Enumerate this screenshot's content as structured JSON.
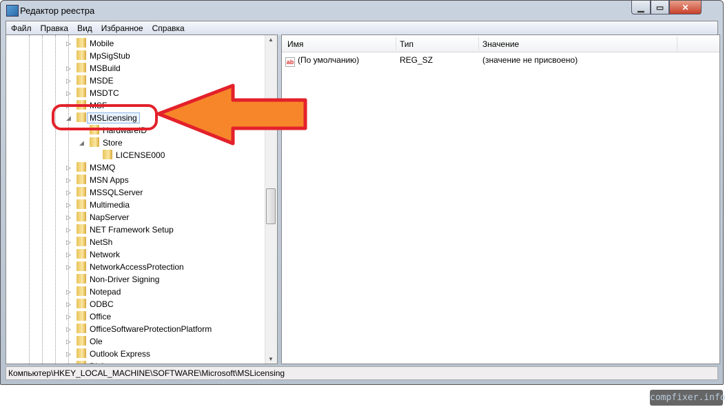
{
  "window": {
    "title": "Редактор реестра",
    "minimize": "▁",
    "maximize": "▭",
    "close": "✕"
  },
  "menu": [
    "Файл",
    "Правка",
    "Вид",
    "Избранное",
    "Справка"
  ],
  "tree": [
    {
      "label": "Mobile",
      "level": 0,
      "expander": "collapsed"
    },
    {
      "label": "MpSigStub",
      "level": 0,
      "expander": "none"
    },
    {
      "label": "MSBuild",
      "level": 0,
      "expander": "collapsed"
    },
    {
      "label": "MSDE",
      "level": 0,
      "expander": "collapsed"
    },
    {
      "label": "MSDTC",
      "level": 0,
      "expander": "collapsed"
    },
    {
      "label": "MSF",
      "level": 0,
      "expander": "collapsed"
    },
    {
      "label": "MSLicensing",
      "level": 0,
      "expander": "expanded",
      "selected": true
    },
    {
      "label": "HardwareID",
      "level": 1,
      "expander": "none"
    },
    {
      "label": "Store",
      "level": 1,
      "expander": "expanded"
    },
    {
      "label": "LICENSE000",
      "level": 2,
      "expander": "none"
    },
    {
      "label": "MSMQ",
      "level": 0,
      "expander": "collapsed"
    },
    {
      "label": "MSN Apps",
      "level": 0,
      "expander": "collapsed"
    },
    {
      "label": "MSSQLServer",
      "level": 0,
      "expander": "collapsed"
    },
    {
      "label": "Multimedia",
      "level": 0,
      "expander": "collapsed"
    },
    {
      "label": "NapServer",
      "level": 0,
      "expander": "collapsed"
    },
    {
      "label": "NET Framework Setup",
      "level": 0,
      "expander": "collapsed"
    },
    {
      "label": "NetSh",
      "level": 0,
      "expander": "collapsed"
    },
    {
      "label": "Network",
      "level": 0,
      "expander": "collapsed"
    },
    {
      "label": "NetworkAccessProtection",
      "level": 0,
      "expander": "collapsed"
    },
    {
      "label": "Non-Driver Signing",
      "level": 0,
      "expander": "none"
    },
    {
      "label": "Notepad",
      "level": 0,
      "expander": "collapsed"
    },
    {
      "label": "ODBC",
      "level": 0,
      "expander": "collapsed"
    },
    {
      "label": "Office",
      "level": 0,
      "expander": "collapsed"
    },
    {
      "label": "OfficeSoftwareProtectionPlatform",
      "level": 0,
      "expander": "collapsed"
    },
    {
      "label": "Ole",
      "level": 0,
      "expander": "collapsed"
    },
    {
      "label": "Outlook Express",
      "level": 0,
      "expander": "collapsed"
    },
    {
      "label": "PLA",
      "level": 0,
      "expander": "collapsed"
    }
  ],
  "columns": {
    "name": "Имя",
    "type": "Тип",
    "value": "Значение"
  },
  "values": [
    {
      "icon": "string-value-icon",
      "name": "(По умолчанию)",
      "type": "REG_SZ",
      "data": "(значение не присвоено)"
    }
  ],
  "status_path": "Компьютер\\HKEY_LOCAL_MACHINE\\SOFTWARE\\Microsoft\\MSLicensing",
  "watermark": "compfixer.info",
  "annotation_colors": {
    "outline": "#e3212b",
    "arrow_fill": "#f7862a"
  }
}
